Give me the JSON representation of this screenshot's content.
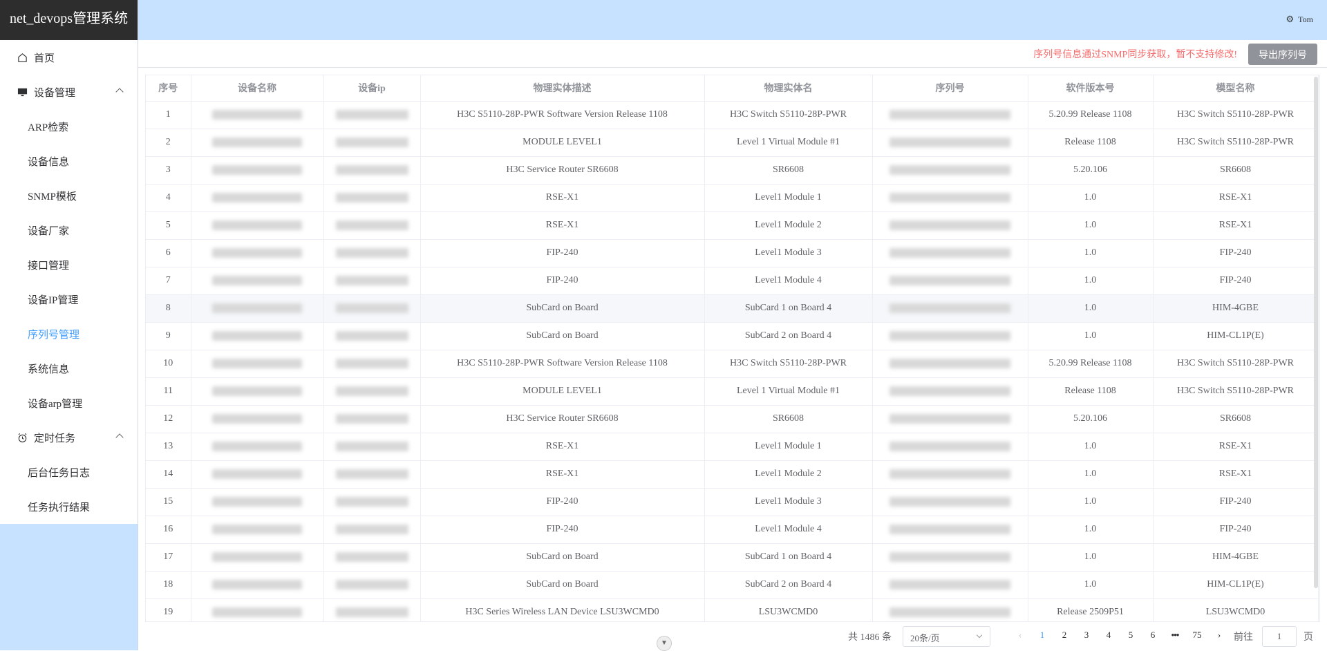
{
  "app": {
    "logo": "net_devops管理系统",
    "user": "Tom"
  },
  "sidebar": {
    "items": [
      {
        "label": "首页",
        "icon": "home-icon",
        "level": "top"
      },
      {
        "label": "设备管理",
        "icon": "monitor-icon",
        "level": "top",
        "expanded": true
      },
      {
        "label": "ARP检索",
        "level": "sub"
      },
      {
        "label": "设备信息",
        "level": "sub"
      },
      {
        "label": "SNMP模板",
        "level": "sub"
      },
      {
        "label": "设备厂家",
        "level": "sub"
      },
      {
        "label": "接口管理",
        "level": "sub"
      },
      {
        "label": "设备IP管理",
        "level": "sub"
      },
      {
        "label": "序列号管理",
        "level": "sub",
        "active": true
      },
      {
        "label": "系统信息",
        "level": "sub"
      },
      {
        "label": "设备arp管理",
        "level": "sub"
      },
      {
        "label": "定时任务",
        "icon": "alarm-clock-icon",
        "level": "top",
        "expanded": true
      },
      {
        "label": "后台任务日志",
        "level": "sub"
      },
      {
        "label": "任务执行结果",
        "level": "sub"
      }
    ]
  },
  "toolbar": {
    "notice": "序列号信息通过SNMP同步获取，暂不支持修改!",
    "export_label": "导出序列号"
  },
  "table": {
    "columns": [
      "序号",
      "设备名称",
      "设备ip",
      "物理实体描述",
      "物理实体名",
      "序列号",
      "软件版本号",
      "模型名称"
    ],
    "rows": [
      [
        "1",
        "",
        "",
        "H3C S5110-28P-PWR Software Version Release 1108",
        "H3C Switch S5110-28P-PWR",
        "",
        "5.20.99 Release 1108",
        "H3C Switch S5110-28P-PWR"
      ],
      [
        "2",
        "",
        "",
        "MODULE LEVEL1",
        "Level 1 Virtual Module #1",
        "",
        "Release 1108",
        "H3C Switch S5110-28P-PWR"
      ],
      [
        "3",
        "",
        "",
        "H3C Service Router SR6608",
        "SR6608",
        "",
        "5.20.106",
        "SR6608"
      ],
      [
        "4",
        "",
        "",
        "RSE-X1",
        "Level1 Module 1",
        "",
        "1.0",
        "RSE-X1"
      ],
      [
        "5",
        "",
        "",
        "RSE-X1",
        "Level1 Module 2",
        "",
        "1.0",
        "RSE-X1"
      ],
      [
        "6",
        "",
        "",
        "FIP-240",
        "Level1 Module 3",
        "",
        "1.0",
        "FIP-240"
      ],
      [
        "7",
        "",
        "",
        "FIP-240",
        "Level1 Module 4",
        "",
        "1.0",
        "FIP-240"
      ],
      [
        "8",
        "",
        "",
        "SubCard on Board",
        "SubCard 1 on Board 4",
        "",
        "1.0",
        "HIM-4GBE"
      ],
      [
        "9",
        "",
        "",
        "SubCard on Board",
        "SubCard 2 on Board 4",
        "",
        "1.0",
        "HIM-CL1P(E)"
      ],
      [
        "10",
        "",
        "",
        "H3C S5110-28P-PWR Software Version Release 1108",
        "H3C Switch S5110-28P-PWR",
        "",
        "5.20.99 Release 1108",
        "H3C Switch S5110-28P-PWR"
      ],
      [
        "11",
        "",
        "",
        "MODULE LEVEL1",
        "Level 1 Virtual Module #1",
        "",
        "Release 1108",
        "H3C Switch S5110-28P-PWR"
      ],
      [
        "12",
        "",
        "",
        "H3C Service Router SR6608",
        "SR6608",
        "",
        "5.20.106",
        "SR6608"
      ],
      [
        "13",
        "",
        "",
        "RSE-X1",
        "Level1 Module 1",
        "",
        "1.0",
        "RSE-X1"
      ],
      [
        "14",
        "",
        "",
        "RSE-X1",
        "Level1 Module 2",
        "",
        "1.0",
        "RSE-X1"
      ],
      [
        "15",
        "",
        "",
        "FIP-240",
        "Level1 Module 3",
        "",
        "1.0",
        "FIP-240"
      ],
      [
        "16",
        "",
        "",
        "FIP-240",
        "Level1 Module 4",
        "",
        "1.0",
        "FIP-240"
      ],
      [
        "17",
        "",
        "",
        "SubCard on Board",
        "SubCard 1 on Board 4",
        "",
        "1.0",
        "HIM-4GBE"
      ],
      [
        "18",
        "",
        "",
        "SubCard on Board",
        "SubCard 2 on Board 4",
        "",
        "1.0",
        "HIM-CL1P(E)"
      ],
      [
        "19",
        "",
        "",
        "H3C Series Wireless LAN Device LSU3WCMD0",
        "LSU3WCMD0",
        "",
        "Release 2509P51",
        "LSU3WCMD0"
      ]
    ],
    "hover_row": 8
  },
  "pagination": {
    "total": "共 1486 条",
    "page_size": "20条/页",
    "pages": [
      "1",
      "2",
      "3",
      "4",
      "5",
      "6",
      "•••",
      "75"
    ],
    "current": "1",
    "goto_prefix": "前往",
    "goto_value": "1",
    "goto_suffix": "页"
  },
  "colors": {
    "accent": "#409eff",
    "header_bg": "#c6e2ff",
    "logo_bg": "#2d2d2d",
    "notice": "#f56c6c"
  }
}
